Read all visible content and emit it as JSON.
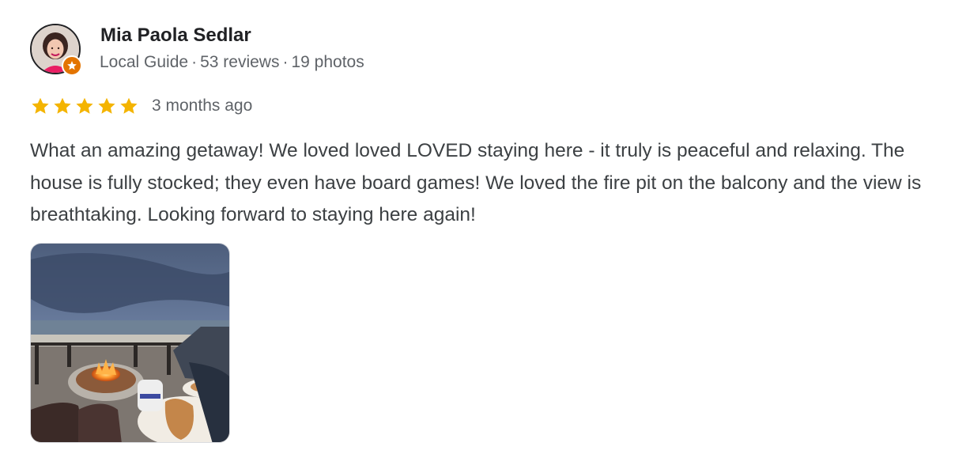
{
  "review": {
    "author": {
      "name": "Mia Paola Sedlar",
      "badge": "Local Guide",
      "reviews": "53 reviews",
      "photos": "19 photos",
      "separator": "·",
      "avatar_icon": "user-avatar-photo",
      "badge_icon": "local-guide-star-icon",
      "badge_color": "#e37400"
    },
    "rating": {
      "stars": 5,
      "max": 5,
      "star_color": "#f4b400",
      "date": "3 months ago"
    },
    "text": "What an amazing getaway! We loved loved LOVED staying here - it truly is peaceful and relaxing. The house is fully stocked; they even have board games! We loved the fire pit on the balcony and the view is breathtaking. Looking forward to staying here again!",
    "photo": {
      "icon": "review-photo-fire-pit-beach"
    }
  }
}
